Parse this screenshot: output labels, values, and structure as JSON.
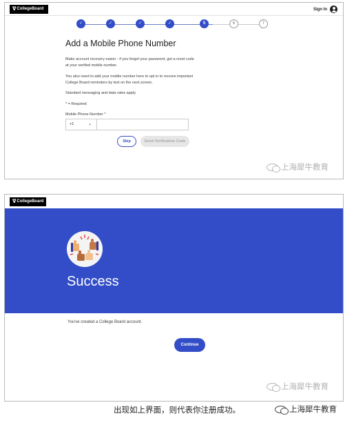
{
  "screen1": {
    "logo": "CollegeBoard",
    "sign_in": "Sign In",
    "steps": [
      {
        "label": "✓",
        "state": "done"
      },
      {
        "label": "✓",
        "state": "done"
      },
      {
        "label": "✓",
        "state": "done"
      },
      {
        "label": "✓",
        "state": "done"
      },
      {
        "label": "5",
        "state": "current"
      },
      {
        "label": "6",
        "state": "todo"
      },
      {
        "label": "7",
        "state": "todo"
      }
    ],
    "title": "Add a Mobile Phone Number",
    "paragraph1": "Make account recovery easier - if you forget your password, get a reset code at your verified mobile number.",
    "paragraph2": "You also need to add your mobile number here to opt in to receive important College Board reminders by text on the next screen.",
    "paragraph3": "Standard messaging and data rates apply.",
    "required_note": "* = Required",
    "phone_label": "Mobile Phone Number *",
    "country_code": "+1",
    "phone_value": "",
    "skip_label": "Skip",
    "send_code_label": "Send Verification Code"
  },
  "screen2": {
    "logo": "CollegeBoard",
    "success_title": "Success",
    "created_text": "You've created a College Board account.",
    "continue_label": "Continue"
  },
  "watermark": "上海犀牛教育",
  "caption": "出现如上界面，则代表你注册成功。",
  "colors": {
    "brand_blue": "#324dc7",
    "disabled_button": "#e6e6e6",
    "watermark_grey": "#b2b2b2"
  },
  "icons": [
    "college-board-logo-icon",
    "user-icon",
    "check-icon",
    "chevron-down-icon",
    "thumbs-up-avatar",
    "wechat-icon"
  ]
}
